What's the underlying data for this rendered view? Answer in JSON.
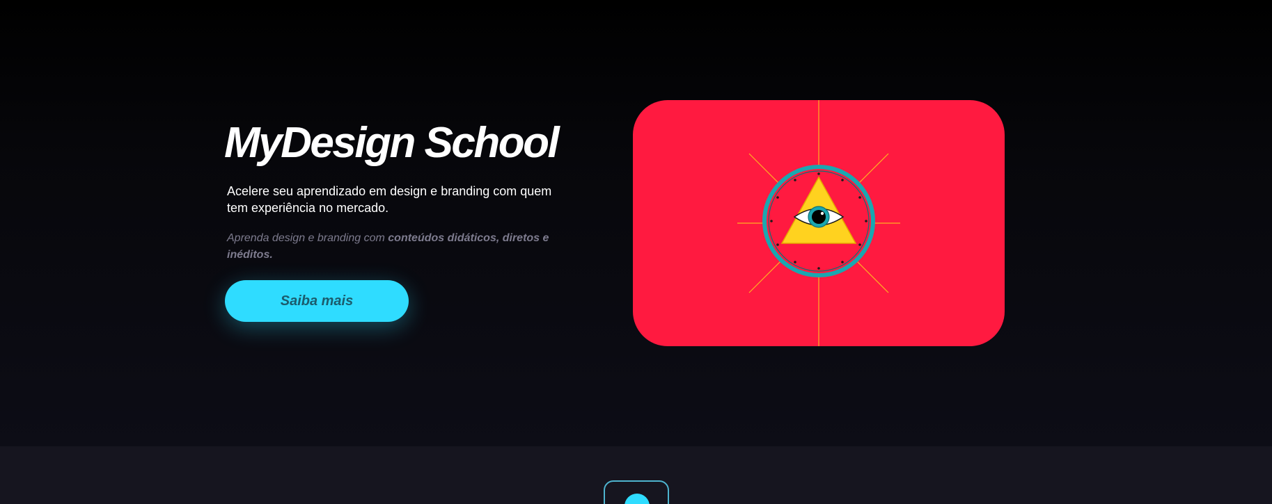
{
  "hero": {
    "title": "MyDesign School",
    "subtitle": "Acelere seu aprendizado em design e branding com quem tem experiência no mercado.",
    "note_prefix": "Aprenda design e branding com ",
    "note_emphasis": "conteúdos didáticos, diretos e inéditos.",
    "cta_label": "Saiba mais"
  },
  "illustration": {
    "icon": "eye-of-providence-icon",
    "background_color": "#ff1a40",
    "accent_color": "#ffd21f",
    "ring_color": "#1aa7b0"
  },
  "scroll_indicator": {
    "icon": "chevron-down-icon",
    "glyph": "⌄"
  },
  "colors": {
    "accent": "#2fdcff",
    "background": "#0d0d16",
    "section_background": "#16151f",
    "muted_text": "#7d7b8e"
  }
}
